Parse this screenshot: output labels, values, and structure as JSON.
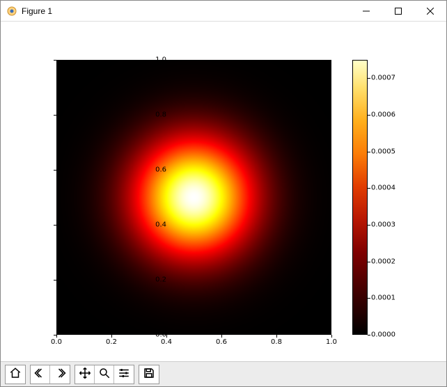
{
  "window": {
    "title": "Figure 1"
  },
  "chart_data": {
    "type": "heatmap",
    "description": "2D gaussian-like intensity field centered near (0.5, 0.5) with radial falloff, colormap 'hot' (black→red→yellow→white)",
    "x_range": [
      0.0,
      1.0
    ],
    "y_range": [
      0.0,
      1.0
    ],
    "x_ticks": [
      "0.0",
      "0.2",
      "0.4",
      "0.6",
      "0.8",
      "1.0"
    ],
    "y_ticks": [
      "0.0",
      "0.2",
      "0.4",
      "0.6",
      "0.8",
      "1.0"
    ],
    "center": [
      0.5,
      0.5
    ],
    "approx_sigma": 0.15,
    "value_min": 0.0,
    "value_max": 0.00075,
    "colormap": "hot",
    "samples": [
      {
        "x": 0.5,
        "y": 0.5,
        "v": 0.00075
      },
      {
        "x": 0.35,
        "y": 0.5,
        "v": 0.00045
      },
      {
        "x": 0.65,
        "y": 0.5,
        "v": 0.00045
      },
      {
        "x": 0.5,
        "y": 0.35,
        "v": 0.00045
      },
      {
        "x": 0.5,
        "y": 0.65,
        "v": 0.00045
      },
      {
        "x": 0.25,
        "y": 0.5,
        "v": 0.00015
      },
      {
        "x": 0.1,
        "y": 0.1,
        "v": 1e-05
      },
      {
        "x": 0.9,
        "y": 0.9,
        "v": 1e-05
      }
    ],
    "colorbar": {
      "ticks": [
        "0.0000",
        "0.0001",
        "0.0002",
        "0.0003",
        "0.0004",
        "0.0005",
        "0.0006",
        "0.0007"
      ]
    }
  },
  "toolbar": {
    "home_title": "Reset original view",
    "back_title": "Back to previous view",
    "forward_title": "Forward to next view",
    "pan_title": "Pan axes",
    "zoom_title": "Zoom to rectangle",
    "configure_title": "Configure subplots",
    "save_title": "Save the figure"
  }
}
